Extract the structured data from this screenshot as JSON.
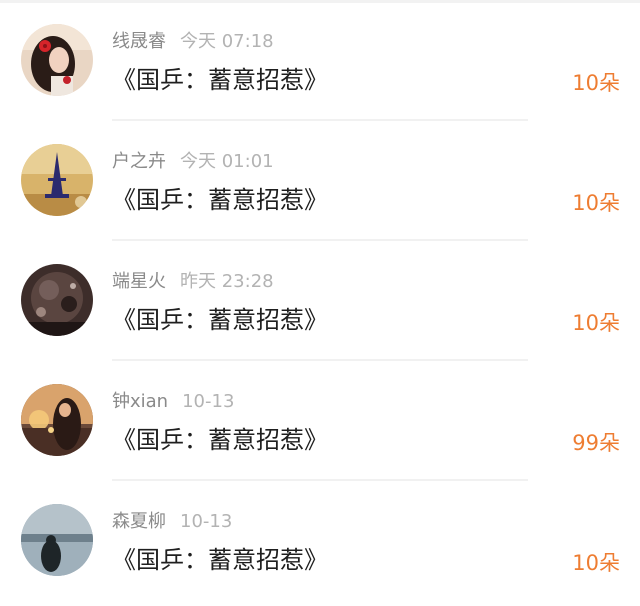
{
  "colors": {
    "username": "#8a8a8a",
    "timestamp": "#b3b3b3",
    "title": "#1f1f1f",
    "count_accent": "#ee7d32"
  },
  "list": {
    "items": [
      {
        "name": "线晟睿",
        "time": "今天 07:18",
        "title": "《国乒：蓄意招惹》",
        "count": "10朵",
        "avatar_icon": "girl-with-red-flower-avatar"
      },
      {
        "name": "户之卉",
        "time": "今天 01:01",
        "title": "《国乒：蓄意招惹》",
        "count": "10朵",
        "avatar_icon": "eiffel-tower-avatar"
      },
      {
        "name": "端星火",
        "time": "昨天 23:28",
        "title": "《国乒：蓄意招惹》",
        "count": "10朵",
        "avatar_icon": "dark-crystal-avatar"
      },
      {
        "name": "钟xian",
        "time": "10-13",
        "title": "《国乒：蓄意招惹》",
        "count": "99朵",
        "avatar_icon": "girl-at-sunset-avatar"
      },
      {
        "name": "森夏柳",
        "time": "10-13",
        "title": "《国乒：蓄意招惹》",
        "count": "10朵",
        "avatar_icon": "lake-silhouette-avatar"
      }
    ]
  }
}
